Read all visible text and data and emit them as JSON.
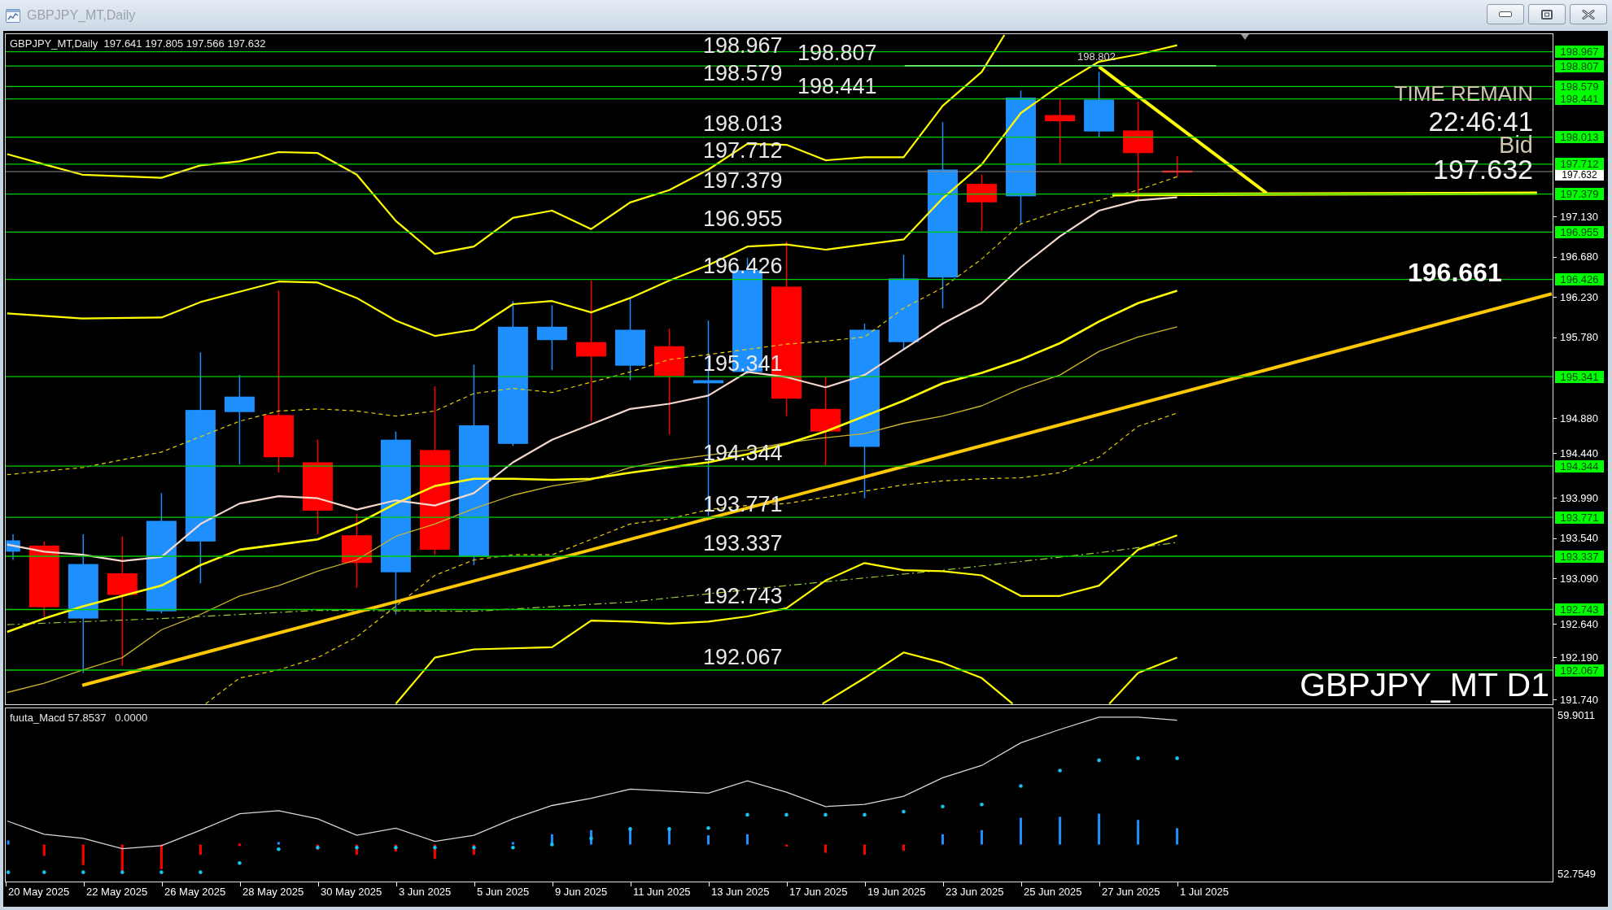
{
  "window": {
    "title": "GBPJPY_MT,Daily",
    "active": false
  },
  "chart": {
    "header": "GBPJPY_MT,Daily  197.641 197.805 197.566 197.632",
    "levels": [
      {
        "chart_label": "198.967",
        "axis_label": "198.967"
      },
      {
        "chart_label": "198.807",
        "axis_label": "198.807"
      },
      {
        "chart_label": "198.579",
        "axis_label": "198.579"
      },
      {
        "chart_label": "198.441",
        "axis_label": "198.441"
      },
      {
        "chart_label": "198.013",
        "axis_label": "198.013"
      },
      {
        "chart_label": "197.712",
        "axis_label": "197.712"
      },
      {
        "chart_label": "197.379",
        "axis_label": "197.379"
      },
      {
        "chart_label": "196.955",
        "axis_label": "196.955"
      },
      {
        "chart_label": "196.426",
        "axis_label": "196.426"
      },
      {
        "chart_label": "195.341",
        "axis_label": "195.341"
      },
      {
        "chart_label": "194.344",
        "axis_label": "194.344"
      },
      {
        "chart_label": "193.771",
        "axis_label": "193.771"
      },
      {
        "chart_label": "193.337",
        "axis_label": "193.337"
      },
      {
        "chart_label": "192.743",
        "axis_label": "192.743"
      },
      {
        "chart_label": "192.067",
        "axis_label": "192.067"
      }
    ],
    "high_marker_label": "198.802",
    "timer": {
      "title": "TIME REMAIN",
      "value": "22:46:41",
      "bid_label": "Bid",
      "bid_value": "197.632"
    },
    "price_marker": "196.661",
    "symbol_label": "GBPJPY_MT D1",
    "price_axis": {
      "ticks": [
        "197.130",
        "196.680",
        "196.230",
        "195.780",
        "194.880",
        "194.440",
        "193.990",
        "193.540",
        "193.090",
        "192.640",
        "192.190",
        "191.740"
      ],
      "current_price": "197.632"
    }
  },
  "indicator": {
    "header": "fuuta_Macd 57.8537   0.0000",
    "axis_max": "59.9011",
    "axis_min": "52.7549"
  },
  "time_axis": [
    "20 May 2025",
    "22 May 2025",
    "26 May 2025",
    "28 May 2025",
    "30 May 2025",
    "3 Jun 2025",
    "5 Jun 2025",
    "9 Jun 2025",
    "11 Jun 2025",
    "13 Jun 2025",
    "17 Jun 2025",
    "19 Jun 2025",
    "23 Jun 2025",
    "25 Jun 2025",
    "27 Jun 2025",
    "1 Jul 2025"
  ]
}
